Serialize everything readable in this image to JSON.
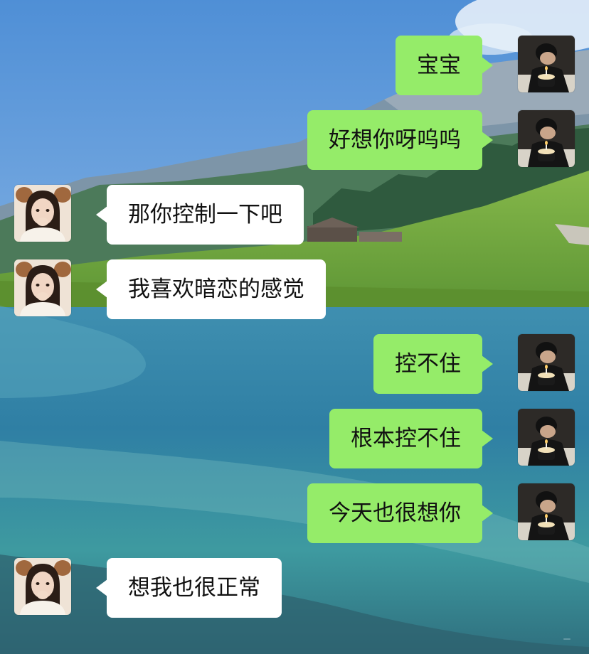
{
  "background": {
    "scene": "mountain-lake-background"
  },
  "messages": [
    {
      "side": "right",
      "text": "宝宝"
    },
    {
      "side": "right",
      "text": "好想你呀呜呜"
    },
    {
      "side": "left",
      "text": "那你控制一下吧"
    },
    {
      "side": "left",
      "text": "我喜欢暗恋的感觉"
    },
    {
      "side": "right",
      "text": "控不住"
    },
    {
      "side": "right",
      "text": "根本控不住"
    },
    {
      "side": "right",
      "text": "今天也很想你"
    },
    {
      "side": "left",
      "text": "想我也很正常"
    }
  ],
  "colors": {
    "sent_bubble": "#95ec69",
    "received_bubble": "#ffffff",
    "text": "#111111"
  },
  "avatars": {
    "right": "boy-with-cake-avatar",
    "left": "girl-avatar"
  }
}
